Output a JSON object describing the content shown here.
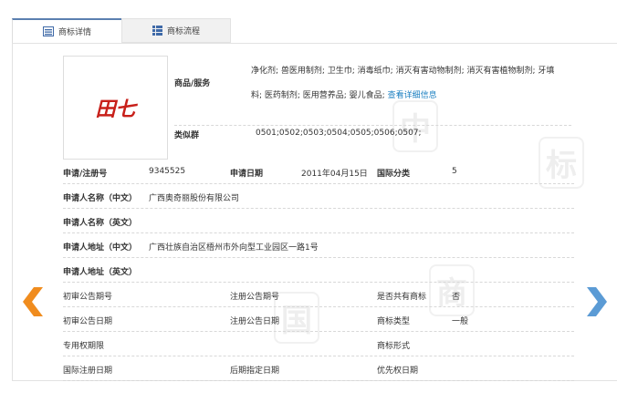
{
  "tabs": [
    {
      "label": "商标详情",
      "icon": "document-list-icon",
      "active": true
    },
    {
      "label": "商标流程",
      "icon": "grid-list-icon",
      "active": false
    }
  ],
  "logo_text": "田七",
  "goods": {
    "label": "商品/服务",
    "line1": "净化剂; 兽医用制剂; 卫生巾; 消毒纸巾; 消灭有害动物制剂; 消灭有害植物制剂; 牙填",
    "line2": "料; 医药制剂; 医用营养品; 婴儿食品;",
    "link": "查看详细信息"
  },
  "similar": {
    "label": "类似群",
    "value": "0501;0502;0503;0504;0505;0506;0507;"
  },
  "row1": {
    "reg_label": "申请/注册号",
    "reg": "9345525",
    "date_label": "申请日期",
    "date": "2011年04月15日",
    "class_label": "国际分类",
    "class": "5"
  },
  "applicant": [
    {
      "label": "申请人名称（中文）",
      "value": "广西奥奇丽股份有限公司"
    },
    {
      "label": "申请人名称（英文）",
      "value": ""
    },
    {
      "label": "申请人地址（中文）",
      "value": "广西壮族自治区梧州市外向型工业园区一路1号"
    },
    {
      "label": "申请人地址（英文）",
      "value": ""
    }
  ],
  "grid": [
    [
      {
        "label": "初审公告期号",
        "value": ""
      },
      {
        "label": "注册公告期号",
        "value": ""
      },
      {
        "label": "是否共有商标",
        "value": "否"
      }
    ],
    [
      {
        "label": "初审公告日期",
        "value": ""
      },
      {
        "label": "注册公告日期",
        "value": ""
      },
      {
        "label": "商标类型",
        "value": "一般"
      }
    ],
    [
      {
        "label": "专用权期限",
        "value": ""
      },
      {
        "label": "",
        "value": ""
      },
      {
        "label": "商标形式",
        "value": ""
      }
    ],
    [
      {
        "label": "国际注册日期",
        "value": ""
      },
      {
        "label": "后期指定日期",
        "value": ""
      },
      {
        "label": "优先权日期",
        "value": ""
      }
    ]
  ],
  "watermark": [
    "商",
    "标",
    "中",
    "国"
  ],
  "colors": {
    "prev_arrow": "#f08c1e",
    "next_arrow": "#5b9bd5",
    "link": "#1a7fc0",
    "tab_active": "#5b7fb0"
  }
}
